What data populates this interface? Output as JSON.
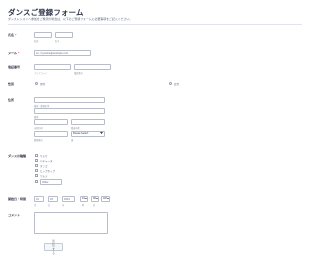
{
  "form": {
    "title": "ダンスご登録フォーム",
    "subtitle": "ダンスレッスンへ参加をご希望の場合は、以下のご登録フォームに必要事項をご記入ください。"
  },
  "name": {
    "label": "氏名",
    "required": "*",
    "first_sub": "名前",
    "last_sub": "名字"
  },
  "email": {
    "label": "メール",
    "required": "*",
    "value": "ex: myname@example.com"
  },
  "phone": {
    "label": "電話番号",
    "area_sub": "エリアコード",
    "number_sub": "電話番号"
  },
  "gender": {
    "label": "性別",
    "options": [
      "男性",
      "女性"
    ]
  },
  "address": {
    "label": "住所",
    "street_sub": "番地・建物名等",
    "line2_sub": "番地",
    "city_sub": "市区町村",
    "state_sub": "都道府県",
    "zip_sub": "郵便番号",
    "country_value": "Please Select",
    "country_sub": "国"
  },
  "dance_type": {
    "label": "ダンスの種類",
    "options": [
      "サルサ",
      "バチャータ",
      "タンゴ",
      "ヒップホップ",
      "ワルツ"
    ],
    "other_value": "Other"
  },
  "start_date": {
    "label": "開始日・時間",
    "month": "01",
    "month_sub": "月",
    "day": "03",
    "day_sub": "日",
    "year": "2024",
    "year_sub": "年",
    "hour": "01",
    "hour_sub": "時",
    "minute": "00",
    "minute_sub": "分",
    "ampm": "AM"
  },
  "comments": {
    "label": "コメント"
  },
  "submit": {
    "label": "送信する"
  },
  "icons": {
    "dropdown": "chevron-down-icon"
  },
  "colors": {
    "required": "#f23a3c",
    "text": "#2c3345",
    "border": "#b8bdc9"
  }
}
